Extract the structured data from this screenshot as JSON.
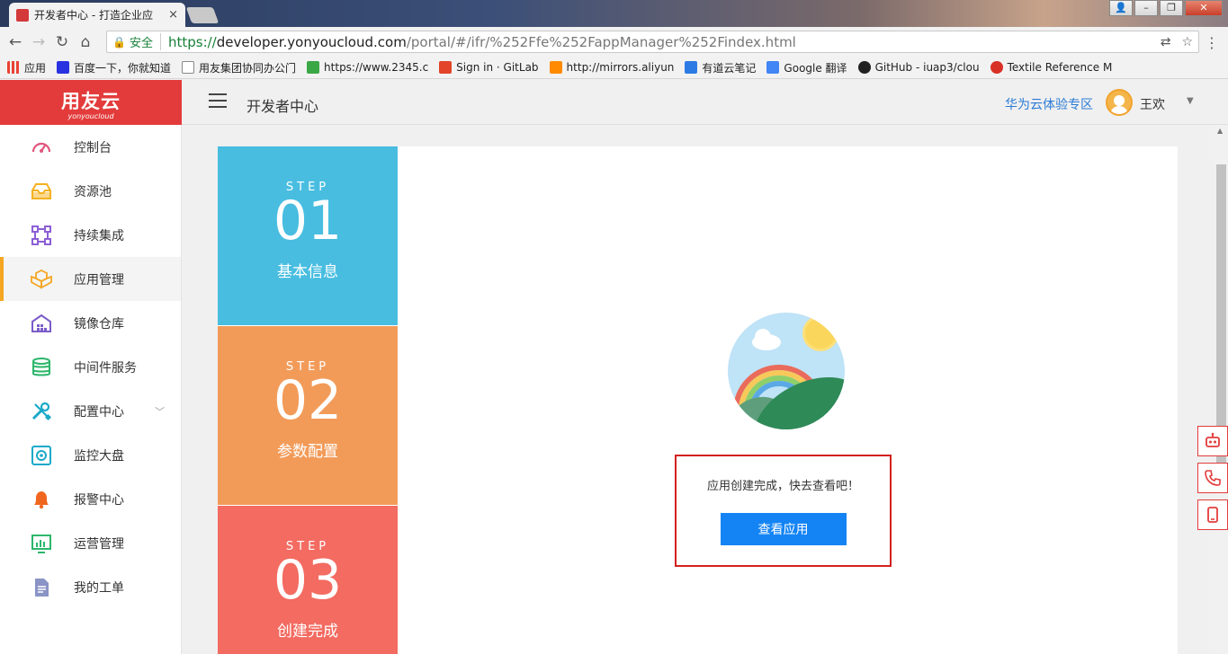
{
  "browser": {
    "tab_title": "开发者中心 - 打造企业应",
    "tab_close": "×",
    "url_secure_label": "安全",
    "url_protocol": "https://",
    "url_host": "developer.yonyoucloud.com",
    "url_path": "/portal/#/ifr/%252Ffe%252FappManager%252Findex.html",
    "bookmarks": [
      {
        "label": "应用",
        "color": "#e94235"
      },
      {
        "label": "百度一下，你就知道",
        "color": "#2932e1"
      },
      {
        "label": "用友集团协同办公门",
        "color": "#888888"
      },
      {
        "label": "https://www.2345.c",
        "color": "#3aa845"
      },
      {
        "label": "Sign in · GitLab",
        "color": "#e24329"
      },
      {
        "label": "http://mirrors.aliyun",
        "color": "#ff8a00"
      },
      {
        "label": "有道云笔记",
        "color": "#2c7be5"
      },
      {
        "label": "Google 翻译",
        "color": "#4285f4"
      },
      {
        "label": "GitHub - iuap3/clou",
        "color": "#222222"
      },
      {
        "label": "Textile Reference M",
        "color": "#d93025"
      }
    ]
  },
  "header": {
    "logo_text": "用友云",
    "logo_sub": "yonyoucloud",
    "page_title": "开发者中心",
    "zone_link": "华为云体验专区",
    "username": "王欢"
  },
  "sidebar": {
    "items": [
      {
        "label": "控制台",
        "icon": "dashboard-icon",
        "color": "#e0577d"
      },
      {
        "label": "资源池",
        "icon": "inbox-icon",
        "color": "#f5b120"
      },
      {
        "label": "持续集成",
        "icon": "integration-icon",
        "color": "#8c5fd6"
      },
      {
        "label": "应用管理",
        "icon": "cubes-icon",
        "color": "#f5a623"
      },
      {
        "label": "镜像仓库",
        "icon": "warehouse-icon",
        "color": "#7b5cc9"
      },
      {
        "label": "中间件服务",
        "icon": "database-icon",
        "color": "#2cb66b"
      },
      {
        "label": "配置中心",
        "icon": "tools-icon",
        "color": "#1aa9c9"
      },
      {
        "label": "监控大盘",
        "icon": "monitor-icon",
        "color": "#1aa9c9"
      },
      {
        "label": "报警中心",
        "icon": "bell-icon",
        "color": "#f0661e"
      },
      {
        "label": "运营管理",
        "icon": "chart-icon",
        "color": "#2cb66b"
      },
      {
        "label": "我的工单",
        "icon": "document-icon",
        "color": "#8a94c6"
      }
    ]
  },
  "steps": [
    {
      "label": "STEP",
      "number": "01",
      "name": "基本信息",
      "color": "#48bde0"
    },
    {
      "label": "STEP",
      "number": "02",
      "name": "参数配置",
      "color": "#f29b59"
    },
    {
      "label": "STEP",
      "number": "03",
      "name": "创建完成",
      "color": "#f36b61"
    }
  ],
  "result": {
    "message": "应用创建完成，快去查看吧！",
    "button_label": "查看应用"
  }
}
